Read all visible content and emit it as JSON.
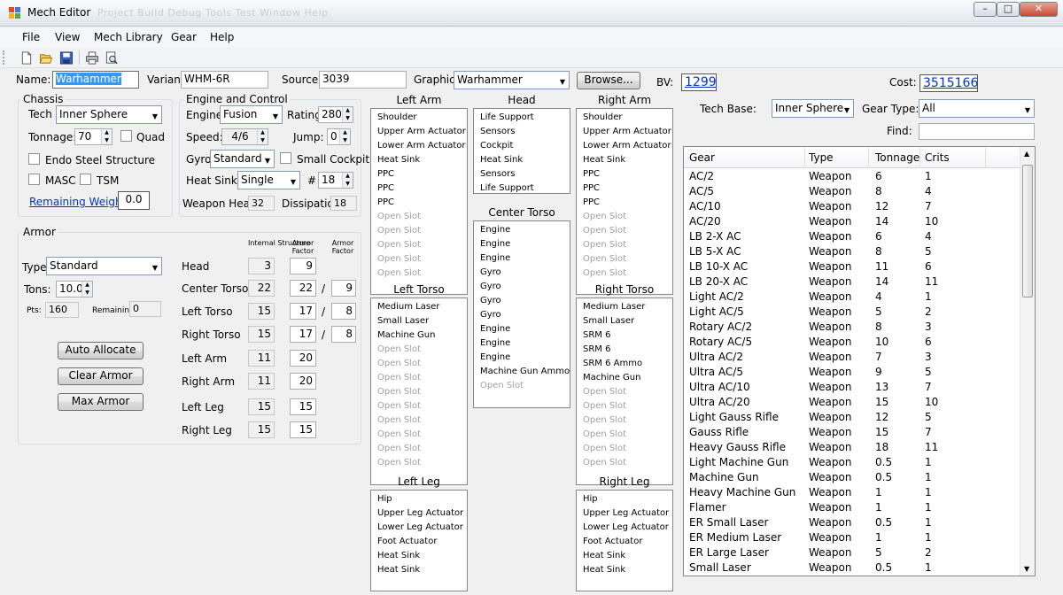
{
  "window": {
    "title": "Mech Editor",
    "ghost_menu": "Project   Build   Debug   Tools   Test   Window   Help",
    "controls": {
      "minimize": "–",
      "maximize": "□",
      "close": "✕"
    }
  },
  "menu": [
    "File",
    "View",
    "Mech Library",
    "Gear",
    "Help"
  ],
  "toolbar": [
    "new-icon",
    "open-icon",
    "save-icon",
    "print-icon",
    "print-preview-icon"
  ],
  "top": {
    "name_label": "Name:",
    "name_value": "Warhammer",
    "variant_label": "Variant:",
    "variant_value": "WHM-6R",
    "source_label": "Source:",
    "source_value": "3039",
    "graphic_label": "Graphic:",
    "graphic_value": "Warhammer",
    "browse_label": "Browse...",
    "bv_label": "BV:",
    "bv_value": "1299",
    "cost_label": "Cost:",
    "cost_value": "3515166"
  },
  "chassis": {
    "title": "Chassis",
    "tech_label": "Tech",
    "tech_value": "Inner Sphere",
    "tonnage_label": "Tonnage:",
    "tonnage_value": "70",
    "quad_label": "Quad",
    "endo_label": "Endo Steel Structure",
    "masc_label": "MASC",
    "tsm_label": "TSM",
    "remaining_label": "Remaining Weight:",
    "remaining_value": "0.0"
  },
  "engine": {
    "title": "Engine and Control",
    "engine_label": "Engine:",
    "engine_value": "Fusion",
    "rating_label": "Rating:",
    "rating_value": "280",
    "speed_label": "Speed:",
    "speed_value": "4/6",
    "jump_label": "Jump:",
    "jump_value": "0",
    "gyro_label": "Gyro:",
    "gyro_value": "Standard",
    "cockpit_label": "Small Cockpit",
    "heatsinks_label": "Heat Sinks:",
    "heatsinks_value": "Single",
    "hash_label": "#",
    "hs_count": "18",
    "weapon_heat_label": "Weapon Heat:",
    "weapon_heat_value": "32",
    "dissipation_label": "Dissipation:",
    "dissipation_value": "18"
  },
  "armor": {
    "title": "Armor",
    "type_label": "Type",
    "type_value": "Standard",
    "tons_label": "Tons:",
    "tons_value": "10.0",
    "pts_label": "Pts:",
    "pts_value": "160",
    "remaining_label": "Remaining",
    "remaining_value": "0",
    "col_internal": "Internal Structure",
    "col_armor_factor": "Armor Factor",
    "col_armor_factor_rear": "Armor Factor",
    "buttons": {
      "auto": "Auto Allocate",
      "clear": "Clear Armor",
      "max": "Max Armor"
    },
    "slash": "/",
    "rows": [
      {
        "label": "Head",
        "internal": "3",
        "armor": "9",
        "rear": ""
      },
      {
        "label": "Center Torso",
        "internal": "22",
        "armor": "22",
        "rear": "9"
      },
      {
        "label": "Left Torso",
        "internal": "15",
        "armor": "17",
        "rear": "8"
      },
      {
        "label": "Right Torso",
        "internal": "15",
        "armor": "17",
        "rear": "8"
      },
      {
        "label": "Left Arm",
        "internal": "11",
        "armor": "20",
        "rear": ""
      },
      {
        "label": "Right Arm",
        "internal": "11",
        "armor": "20",
        "rear": ""
      },
      {
        "label": "Left Leg",
        "internal": "15",
        "armor": "15",
        "rear": ""
      },
      {
        "label": "Right Leg",
        "internal": "15",
        "armor": "15",
        "rear": ""
      }
    ]
  },
  "locations": {
    "left_arm": {
      "title": "Left Arm",
      "slots": [
        "Shoulder",
        "Upper Arm Actuator",
        "Lower Arm Actuator",
        "Heat Sink",
        "PPC",
        "PPC",
        "PPC",
        "Open Slot",
        "Open Slot",
        "Open Slot",
        "Open Slot",
        "Open Slot"
      ]
    },
    "head": {
      "title": "Head",
      "slots": [
        "Life Support",
        "Sensors",
        "Cockpit",
        "Heat Sink",
        "Sensors",
        "Life Support"
      ]
    },
    "right_arm": {
      "title": "Right Arm",
      "slots": [
        "Shoulder",
        "Upper Arm Actuator",
        "Lower Arm Actuator",
        "Heat Sink",
        "PPC",
        "PPC",
        "PPC",
        "Open Slot",
        "Open Slot",
        "Open Slot",
        "Open Slot",
        "Open Slot"
      ]
    },
    "center_torso": {
      "title": "Center Torso",
      "slots": [
        "Engine",
        "Engine",
        "Engine",
        "Gyro",
        "Gyro",
        "Gyro",
        "Gyro",
        "Engine",
        "Engine",
        "Engine",
        "Machine Gun Ammo",
        "Open Slot"
      ]
    },
    "left_torso": {
      "title": "Left Torso",
      "slots": [
        "Medium Laser",
        "Small Laser",
        "Machine Gun",
        "Open Slot",
        "Open Slot",
        "Open Slot",
        "Open Slot",
        "Open Slot",
        "Open Slot",
        "Open Slot",
        "Open Slot",
        "Open Slot"
      ]
    },
    "right_torso": {
      "title": "Right Torso",
      "slots": [
        "Medium Laser",
        "Small Laser",
        "SRM 6",
        "SRM 6",
        "SRM 6 Ammo",
        "Machine Gun",
        "Open Slot",
        "Open Slot",
        "Open Slot",
        "Open Slot",
        "Open Slot",
        "Open Slot"
      ]
    },
    "left_leg": {
      "title": "Left Leg",
      "slots": [
        "Hip",
        "Upper Leg Actuator",
        "Lower Leg Actuator",
        "Foot Actuator",
        "Heat Sink",
        "Heat Sink"
      ]
    },
    "right_leg": {
      "title": "Right Leg",
      "slots": [
        "Hip",
        "Upper Leg Actuator",
        "Lower Leg Actuator",
        "Foot Actuator",
        "Heat Sink",
        "Heat Sink"
      ]
    }
  },
  "gear": {
    "tech_base_label": "Tech Base:",
    "tech_base_value": "Inner Sphere",
    "gear_type_label": "Gear Type:",
    "gear_type_value": "All",
    "find_label": "Find:",
    "find_value": "",
    "columns": [
      "Gear",
      "Type",
      "Tonnage",
      "Crits"
    ],
    "rows": [
      [
        "AC/2",
        "Weapon",
        "6",
        "1"
      ],
      [
        "AC/5",
        "Weapon",
        "8",
        "4"
      ],
      [
        "AC/10",
        "Weapon",
        "12",
        "7"
      ],
      [
        "AC/20",
        "Weapon",
        "14",
        "10"
      ],
      [
        "LB 2-X AC",
        "Weapon",
        "6",
        "4"
      ],
      [
        "LB 5-X AC",
        "Weapon",
        "8",
        "5"
      ],
      [
        "LB 10-X AC",
        "Weapon",
        "11",
        "6"
      ],
      [
        "LB 20-X AC",
        "Weapon",
        "14",
        "11"
      ],
      [
        "Light AC/2",
        "Weapon",
        "4",
        "1"
      ],
      [
        "Light AC/5",
        "Weapon",
        "5",
        "2"
      ],
      [
        "Rotary AC/2",
        "Weapon",
        "8",
        "3"
      ],
      [
        "Rotary AC/5",
        "Weapon",
        "10",
        "6"
      ],
      [
        "Ultra AC/2",
        "Weapon",
        "7",
        "3"
      ],
      [
        "Ultra AC/5",
        "Weapon",
        "9",
        "5"
      ],
      [
        "Ultra AC/10",
        "Weapon",
        "13",
        "7"
      ],
      [
        "Ultra AC/20",
        "Weapon",
        "15",
        "10"
      ],
      [
        "Light Gauss Rifle",
        "Weapon",
        "12",
        "5"
      ],
      [
        "Gauss Rifle",
        "Weapon",
        "15",
        "7"
      ],
      [
        "Heavy Gauss Rifle",
        "Weapon",
        "18",
        "11"
      ],
      [
        "Light Machine Gun",
        "Weapon",
        "0.5",
        "1"
      ],
      [
        "Machine Gun",
        "Weapon",
        "0.5",
        "1"
      ],
      [
        "Heavy Machine Gun",
        "Weapon",
        "1",
        "1"
      ],
      [
        "Flamer",
        "Weapon",
        "1",
        "1"
      ],
      [
        "ER Small Laser",
        "Weapon",
        "0.5",
        "1"
      ],
      [
        "ER Medium Laser",
        "Weapon",
        "1",
        "1"
      ],
      [
        "ER Large Laser",
        "Weapon",
        "5",
        "2"
      ],
      [
        "Small Laser",
        "Weapon",
        "0.5",
        "1"
      ]
    ]
  }
}
